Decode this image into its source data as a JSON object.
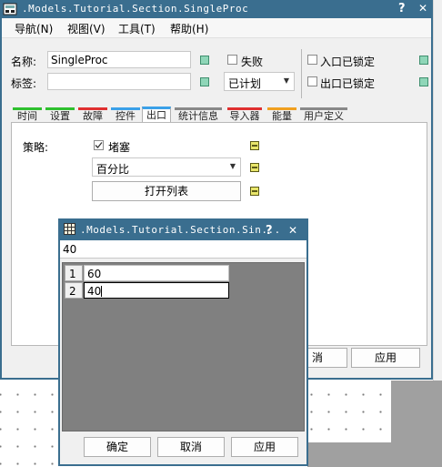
{
  "main_window": {
    "title": ".Models.Tutorial.Section.SingleProc",
    "help_btn": "?",
    "close_btn": "✕"
  },
  "menu": [
    "导航(N)",
    "视图(V)",
    "工具(T)",
    "帮助(H)"
  ],
  "form": {
    "name_label": "名称:",
    "name_value": "SingleProc",
    "label_label": "标签:",
    "label_value": "",
    "failed_label": "失败",
    "entry_locked_label": "入口已锁定",
    "exit_locked_label": "出口已锁定",
    "status_value": "已计划"
  },
  "tabs": [
    {
      "label": "时间",
      "color": "#2ec02e"
    },
    {
      "label": "设置",
      "color": "#2ec02e"
    },
    {
      "label": "故障",
      "color": "#e03030"
    },
    {
      "label": "控件",
      "color": "#3aa0e8"
    },
    {
      "label": "出口",
      "color": "#3aa0e8"
    },
    {
      "label": "统计信息",
      "color": "#888888"
    },
    {
      "label": "导入器",
      "color": "#e03030"
    },
    {
      "label": "能量",
      "color": "#f0a020"
    },
    {
      "label": "用户定义",
      "color": "#888888"
    }
  ],
  "exit_tab": {
    "strategy_label": "策略:",
    "blocking_label": "堵塞",
    "blocking_checked": true,
    "strategy_value": "百分比",
    "open_list_button": "打开列表"
  },
  "main_buttons": {
    "cancel_partial": "消",
    "apply": "应用"
  },
  "popup": {
    "title": ".Models.Tutorial.Section.Sin...",
    "help_btn": "?",
    "close_btn": "✕",
    "input_value": "40",
    "rows": [
      {
        "index": "1",
        "value": "60"
      },
      {
        "index": "2",
        "value": "40"
      }
    ],
    "ok_button": "确定",
    "cancel_button": "取消",
    "apply_button": "应用"
  }
}
